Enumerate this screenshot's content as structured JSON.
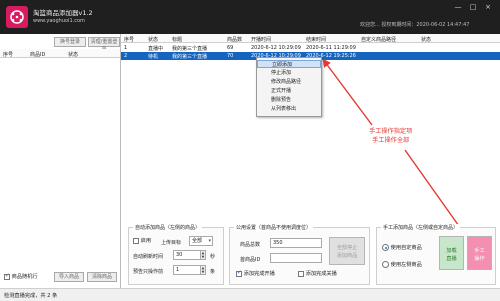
{
  "app": {
    "title": "淘篮商品添加器v1.2",
    "url": "www.yaoghuoi1.com",
    "welcome": "欢迎您...  授权到期时间：2020-06-02 14:47:47",
    "controls": {
      "minimize": "—",
      "maximize": "□",
      "close": "×"
    },
    "brand_color": "#d81b60"
  },
  "left_panel": {
    "buttons": {
      "change_account": "换号登录",
      "reset_login": "清理/重置登录"
    },
    "columns": [
      "序号",
      "商品ID",
      "状态"
    ],
    "footer": {
      "random_label": "商品随机行",
      "random_checked": true,
      "import_button": "导入商品",
      "clear_button": "清除商品"
    }
  },
  "table": {
    "columns": [
      "序号",
      "状态",
      "标题",
      "商品数",
      "开播时间",
      "结束时间",
      "自定义商品路径",
      "状态"
    ],
    "rows": [
      {
        "index": "1",
        "status": "直播中",
        "title": "我的第三个直播",
        "count": "69",
        "start": "2020-6-12 10:29:09",
        "end": "2020-6-11 11:29:09",
        "path": "",
        "state": ""
      },
      {
        "index": "2",
        "status": "待机",
        "title": "我的第三个直播",
        "count": "70",
        "start": "2020-6-12 10:29:09",
        "end": "2020-6-12 19:25:26",
        "path": "",
        "state": "",
        "selected": true
      }
    ]
  },
  "context_menu": {
    "items": [
      "立即添加",
      "停止添加",
      "修改商品路径",
      "正式开播",
      "删除预告",
      "从列表移出"
    ],
    "highlighted_index": 0
  },
  "annotation": {
    "line1": "手工操作指定项",
    "line2": "手工操作全部",
    "color": "#e53935"
  },
  "auto_add": {
    "title": "自动添加商品（左侧的商品）",
    "enable_label": "启用",
    "enabled": false,
    "target_label": "上传目标",
    "target_value": "全部",
    "interval_label": "自动刷新时间",
    "interval_value": "30",
    "interval_unit": "秒",
    "preview_label": "预告只操作前",
    "preview_value": "1",
    "preview_unit": "条"
  },
  "public_settings": {
    "title": "公用设置（首商品不使用调度位）",
    "count_label": "商品总数",
    "count_value": "350",
    "first_id_label": "首商品ID",
    "first_id_value": "",
    "stop_button": "全部停止\n添加商品",
    "auto_open_label": "添加完成开播",
    "auto_open_checked": true,
    "auto_close_label": "添加完成关播",
    "auto_close_checked": false
  },
  "manual_add": {
    "title": "手工添加商品（左侧或自定商品）",
    "use_custom_label": "使用自定商品",
    "use_custom_selected": true,
    "use_left_label": "使用左侧商品",
    "use_left_selected": false,
    "add_button_line1": "加载",
    "add_button_line2": "直播",
    "manual_button_line1": "手工",
    "manual_button_line2": "操作",
    "manual_button_color": "#f48fb1",
    "add_button_color": "#c8e6c9"
  },
  "status_bar": {
    "text": "检测直播完成，共 2 条"
  }
}
